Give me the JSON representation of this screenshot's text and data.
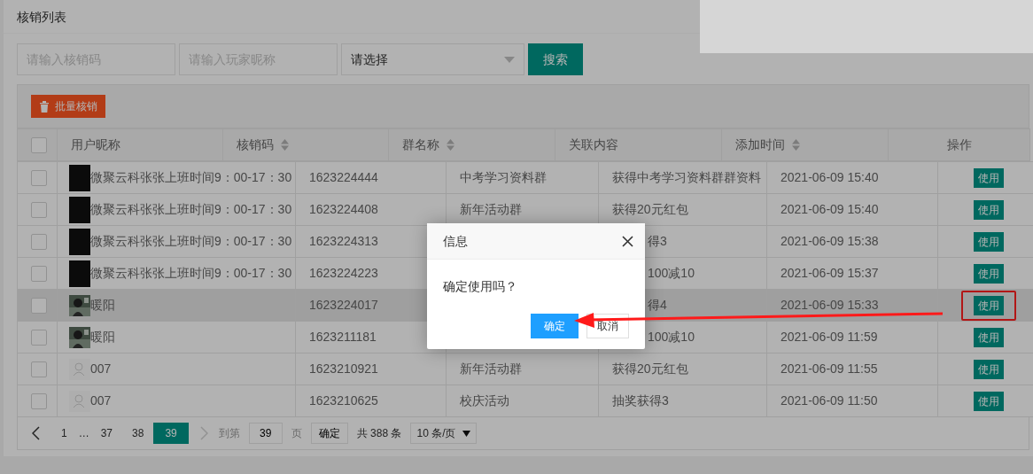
{
  "panel": {
    "title": "核销列表"
  },
  "filters": {
    "code_field": {
      "placeholder": "请输入核销码"
    },
    "nickname_field": {
      "placeholder": "请输入玩家昵称"
    },
    "select": {
      "value": "请选择"
    },
    "search_button": "搜索"
  },
  "toolbar": {
    "batch_button": "批量核销"
  },
  "table": {
    "header_checked": false,
    "columns": [
      {
        "label": "用户昵称",
        "sortable": false
      },
      {
        "label": "核销码",
        "sortable": true
      },
      {
        "label": "群名称",
        "sortable": true
      },
      {
        "label": "关联内容",
        "sortable": false
      },
      {
        "label": "添加时间",
        "sortable": true
      },
      {
        "label": "操作",
        "sortable": false
      }
    ],
    "rows": [
      {
        "checked": false,
        "hovered": false,
        "annotated": false,
        "kind": "dark",
        "nickname": "微聚云科张张上班时间9：00-17：30",
        "code": "1623224444",
        "group": "中考学习资料群",
        "content": "获得中考学习资料群群资料",
        "time": "2021-06-09 15:40",
        "action": "使用"
      },
      {
        "checked": false,
        "hovered": false,
        "annotated": false,
        "kind": "dark",
        "nickname": "微聚云科张张上班时间9：00-17：30",
        "code": "1623224408",
        "group": "新年活动群",
        "content": "获得20元红包",
        "time": "2021-06-09 15:40",
        "action": "使用"
      },
      {
        "checked": false,
        "hovered": false,
        "annotated": false,
        "kind": "dark",
        "nickname": "微聚云科张张上班时间9：00-17：30",
        "code": "1623224313",
        "content": "得3",
        "time": "2021-06-09 15:38",
        "action": "使用"
      },
      {
        "checked": false,
        "hovered": false,
        "annotated": false,
        "kind": "dark",
        "nickname": "微聚云科张张上班时间9：00-17：30",
        "code": "1623224223",
        "content": "100减10",
        "time": "2021-06-09 15:37",
        "action": "使用"
      },
      {
        "checked": false,
        "hovered": true,
        "annotated": true,
        "nickname": "暖阳",
        "code": "1623224017",
        "content": "得4",
        "time": "2021-06-09 15:33",
        "action": "使用"
      },
      {
        "checked": false,
        "hovered": false,
        "annotated": false,
        "nickname": "暖阳",
        "code": "1623211181",
        "content": "100减10",
        "time": "2021-06-09 11:59",
        "action": "使用"
      },
      {
        "checked": false,
        "hovered": false,
        "annotated": false,
        "kind": "default",
        "nickname": "007",
        "code": "1623210921",
        "group": "新年活动群",
        "content": "获得20元红包",
        "time": "2021-06-09 11:55",
        "action": "使用"
      },
      {
        "checked": false,
        "hovered": false,
        "annotated": false,
        "kind": "default",
        "nickname": "007",
        "code": "1623210625",
        "group": "校庆活动",
        "content": "抽奖获得3",
        "time": "2021-06-09 11:50",
        "action": "使用"
      }
    ]
  },
  "pagination": {
    "prev_disabled": false,
    "next_disabled": true,
    "pages": [
      {
        "label": "1",
        "selected": false
      },
      {
        "label": "…",
        "selected": false
      },
      {
        "label": "37",
        "selected": false
      },
      {
        "label": "38",
        "selected": false
      },
      {
        "label": "39",
        "selected": true
      }
    ],
    "goto_label": "到第",
    "goto_value": "39",
    "page_unit": "页",
    "confirm_button": "确定",
    "total": "共 388 条",
    "page_size": "10 条/页"
  },
  "dialog": {
    "title": "信息",
    "message": "确定使用吗？",
    "buttons": [
      {
        "label": "确定",
        "kind": "primary"
      },
      {
        "label": "取消",
        "kind": "secondary"
      }
    ]
  }
}
